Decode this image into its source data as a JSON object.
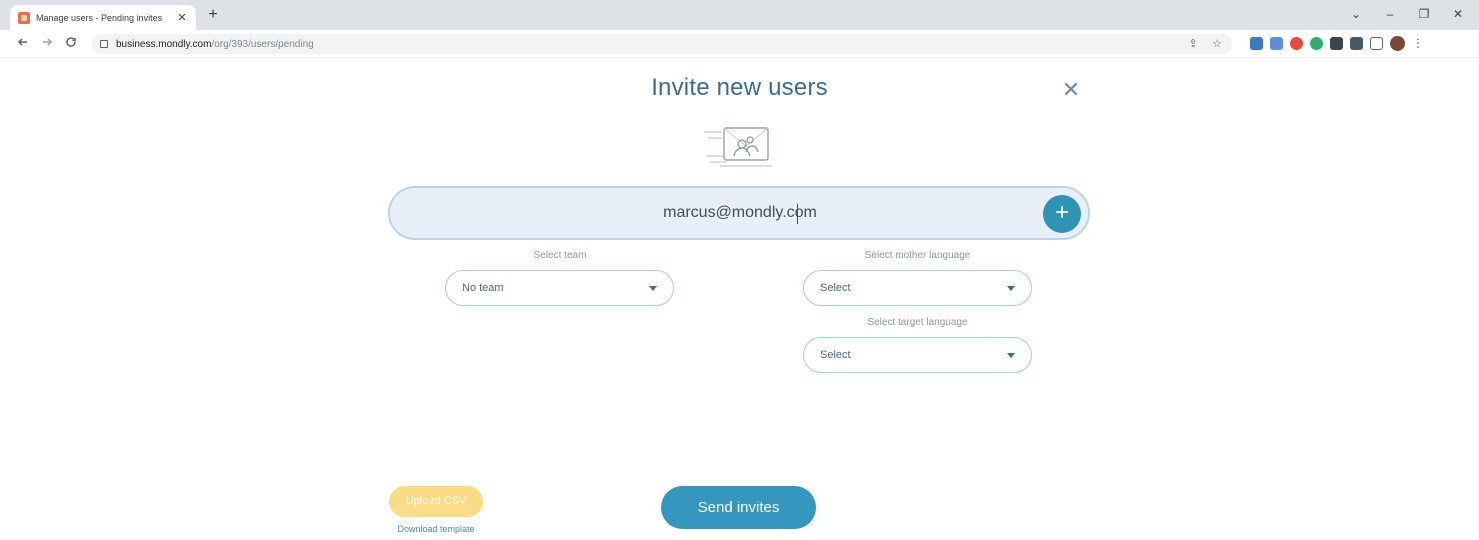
{
  "browser": {
    "tab_title": "Manage users - Pending invites",
    "tab_close": "✕",
    "new_tab": "+",
    "url_host": "business.mondly.com",
    "url_path": "/org/393/users/pending",
    "window_controls": {
      "dropdown": "⌄",
      "minimize": "–",
      "restore": "❐",
      "close": "✕"
    }
  },
  "modal": {
    "title": "Invite new users",
    "close_glyph": "✕",
    "email_value": "marcus@mondly.com",
    "add_glyph": "+",
    "team": {
      "label": "Select team",
      "value": "No team"
    },
    "mother_language": {
      "label": "Select mother language",
      "value": "Select"
    },
    "target_language": {
      "label": "Select target language",
      "value": "Select"
    },
    "upload_csv": "Upload CSV",
    "download_template": "Download template",
    "send_invites": "Send invites"
  },
  "colors": {
    "accent": "#3597bd",
    "title": "#3a6e8f",
    "upload": "#fbd97a",
    "input_bg": "#e9eff8"
  },
  "icons": {
    "back": "arrow-left-icon",
    "forward": "arrow-right-icon",
    "reload": "reload-icon",
    "lock": "lock-icon",
    "share": "share-icon",
    "star": "star-icon",
    "close": "close-icon",
    "add": "plus-icon",
    "dropdown": "chevron-down-icon"
  }
}
